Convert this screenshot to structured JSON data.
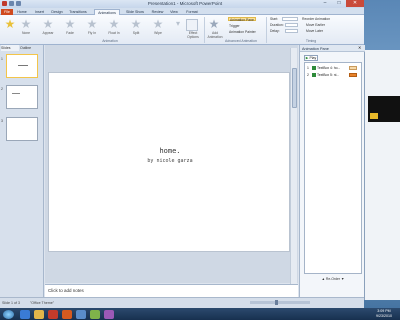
{
  "window": {
    "title": "Presentation1 - Microsoft PowerPoint",
    "controls": [
      "–",
      "□",
      "✕"
    ]
  },
  "ribbon_tabs": [
    "File",
    "Home",
    "Insert",
    "Design",
    "Transitions",
    "Animations",
    "Slide Show",
    "Review",
    "View",
    "Format"
  ],
  "active_tab": "Animations",
  "ribbon": {
    "effects": [
      "None",
      "Appear",
      "Fade",
      "Fly In",
      "Float In",
      "Split",
      "Wipe"
    ],
    "effect_options": "Effect Options",
    "animation_group_label": "Animation",
    "add_animation": "Add Animation",
    "animation_pane_btn": "Animation Pane",
    "trigger_btn": "Trigger",
    "painter_btn": "Animation Painter",
    "advanced_group_label": "Advanced Animation",
    "start": "Start:",
    "duration": "Duration:",
    "delay": "Delay:",
    "reorder_title": "Reorder Animation",
    "move_earlier": "Move Earlier",
    "move_later": "Move Later",
    "timing_group_label": "Timing"
  },
  "left_pane": {
    "tabs": [
      "Slides",
      "Outline"
    ],
    "slides": [
      {
        "num": "1",
        "selected": true
      },
      {
        "num": "2",
        "selected": false
      },
      {
        "num": "3",
        "selected": false
      }
    ]
  },
  "slide": {
    "title": "home.",
    "subtitle": "by nicole garza"
  },
  "notes_placeholder": "Click to add notes",
  "animation_pane": {
    "title": "Animation Pane",
    "play": "Play",
    "items": [
      {
        "num": "1",
        "label": "TextBox 4: ho...",
        "color": "#f6d8a8"
      },
      {
        "num": "2",
        "label": "TextBox 5: ni...",
        "color": "#e8822a"
      }
    ],
    "reorder": "Re-Order"
  },
  "status": {
    "slide": "Slide 1 of 3",
    "theme": "\"Office Theme\""
  },
  "clock": {
    "time": "3:09 PM",
    "date": "9/23/2010"
  }
}
